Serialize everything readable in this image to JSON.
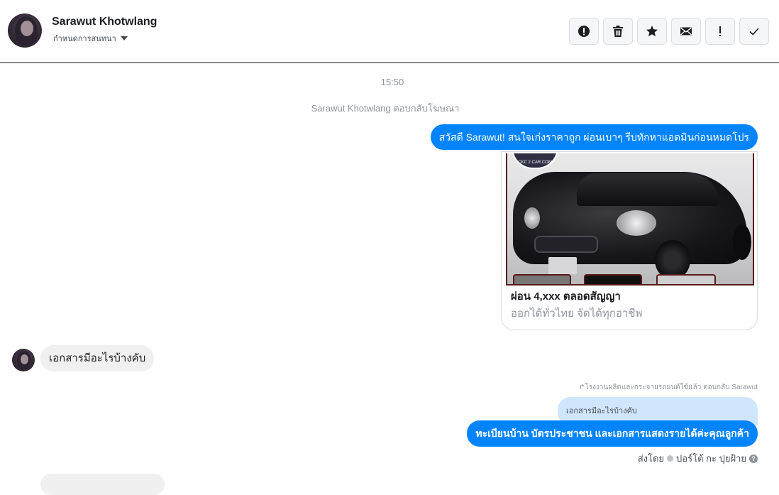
{
  "header": {
    "contact_name": "Sarawut Khotwlang",
    "assign_label": "กำหนดการสนทนา",
    "actions": [
      {
        "icon": "report-icon",
        "name": "mark-spam-button"
      },
      {
        "icon": "trash-icon",
        "name": "delete-button"
      },
      {
        "icon": "star-icon",
        "name": "star-button"
      },
      {
        "icon": "envelope-icon",
        "name": "mark-unread-button"
      },
      {
        "icon": "exclamation-icon",
        "name": "follow-up-button"
      },
      {
        "icon": "check-icon",
        "name": "mark-done-button"
      }
    ]
  },
  "thread": {
    "timestamp": "15:50",
    "system_line": "Sarawut Khotwlang ตอบกลับโฆษณา",
    "outgoing_greeting": "สวัสดี Sarawut! สนใจเก๋งราคาถูก ผ่อนเบาๆ รีบทักหาแอดมินก่อนหมดโปร",
    "ad_card": {
      "logo_text": "CKC 2 CAR.COM",
      "title": "ผ่อน 4,xxx ตลอดสัญญา",
      "subtitle": "ออกได้ทั่วไทย จัดได้ทุกอาชีพ"
    },
    "incoming_message": "เอกสารมีอะไรบ้างคับ",
    "reply_meta": "↱โรงงานผลิตและกระจายรถยนต์ใช้แล้ว ตอบกลับ Sarawut",
    "quoted_text": "เอกสารมีอะไรบ้างคับ",
    "outgoing_reply": "ทะเบียนบ้าน บัตรประชาชน และเอกสารแสดงรายได้ค่ะคุณลูกค้า",
    "sent_by_label": "ส่งโดย",
    "sent_by_name": "ปอร์โต้ กะ ปุยฝ้าย",
    "help_glyph": "?"
  }
}
